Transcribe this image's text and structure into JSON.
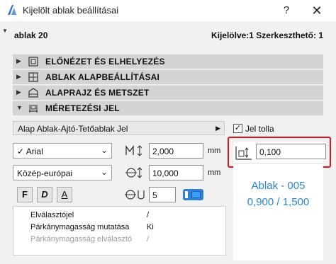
{
  "window": {
    "title": "Kijelölt ablak beállításai",
    "help_label": "?",
    "close_label": "✕"
  },
  "header": {
    "element_name": "ablak 20",
    "selection_info": "Kijelölve:1 Szerkeszthető: 1"
  },
  "sections": [
    {
      "label": "ELŐNÉZET ÉS ELHELYEZÉS",
      "expanded": false
    },
    {
      "label": "ABLAK ALAPBEÁLLÍTÁSAI",
      "expanded": false
    },
    {
      "label": "ALAPRAJZ ÉS METSZET",
      "expanded": false
    },
    {
      "label": "MÉRETEZÉSI JEL",
      "expanded": true
    }
  ],
  "marker": {
    "type_dropdown": "Alap Ablak-Ajtó-Tetőablak Jel",
    "pen_checkbox_label": "Jel tolla",
    "pen_checked": true,
    "font": "Arial",
    "encoding": "Közép-európai",
    "text_height": "2,000",
    "text_height_unit": "mm",
    "offset": "10,000",
    "offset_unit": "mm",
    "pen_number": "5",
    "marker_size": "0,100",
    "style_bold": "F",
    "style_italic": "D",
    "style_underline": "A"
  },
  "properties": [
    {
      "name": "Elválasztójel",
      "value": "/",
      "dim": false
    },
    {
      "name": "Párkánymagasság mutatása",
      "value": "Ki",
      "dim": false
    },
    {
      "name": "Párkánymagasság elválasztó",
      "value": "/",
      "dim": true
    }
  ],
  "preview": {
    "line1": "Ablak - 005",
    "line2": "0,900 / 1,500",
    "color": "#2a86d6"
  },
  "colors": {
    "highlight": "#e0161c",
    "accent": "#2f7fd8"
  }
}
